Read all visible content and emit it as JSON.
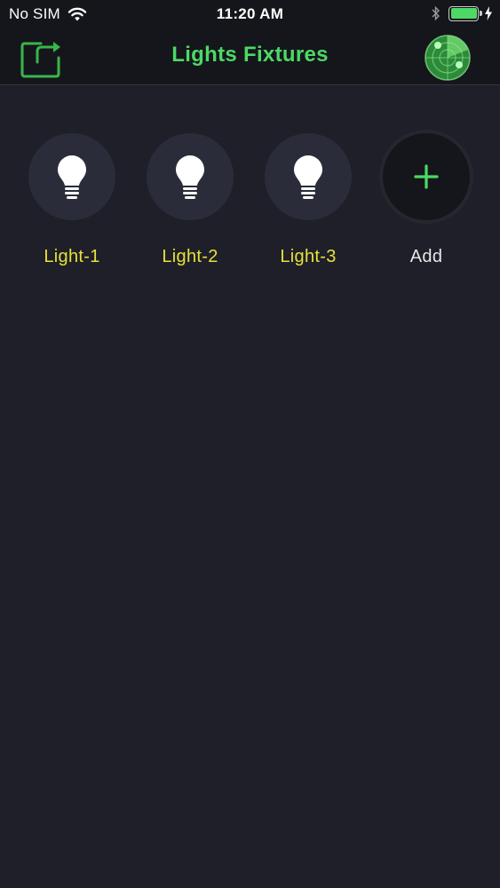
{
  "status": {
    "carrier": "No SIM",
    "time": "11:20 AM",
    "battery_color": "#4cd964"
  },
  "nav": {
    "title": "Lights Fixtures",
    "title_color": "#4cd964",
    "left_icon": "share-icon",
    "right_icon": "radar-icon"
  },
  "fixtures": [
    {
      "label": "Light-1",
      "icon": "light-bulb-icon"
    },
    {
      "label": "Light-2",
      "icon": "light-bulb-icon"
    },
    {
      "label": "Light-3",
      "icon": "light-bulb-icon"
    }
  ],
  "add": {
    "label": "Add",
    "icon": "plus-icon"
  },
  "colors": {
    "background": "#1e1f29",
    "bar": "#15161c",
    "fixture_label": "#e8e03a",
    "accent": "#4cd964"
  }
}
